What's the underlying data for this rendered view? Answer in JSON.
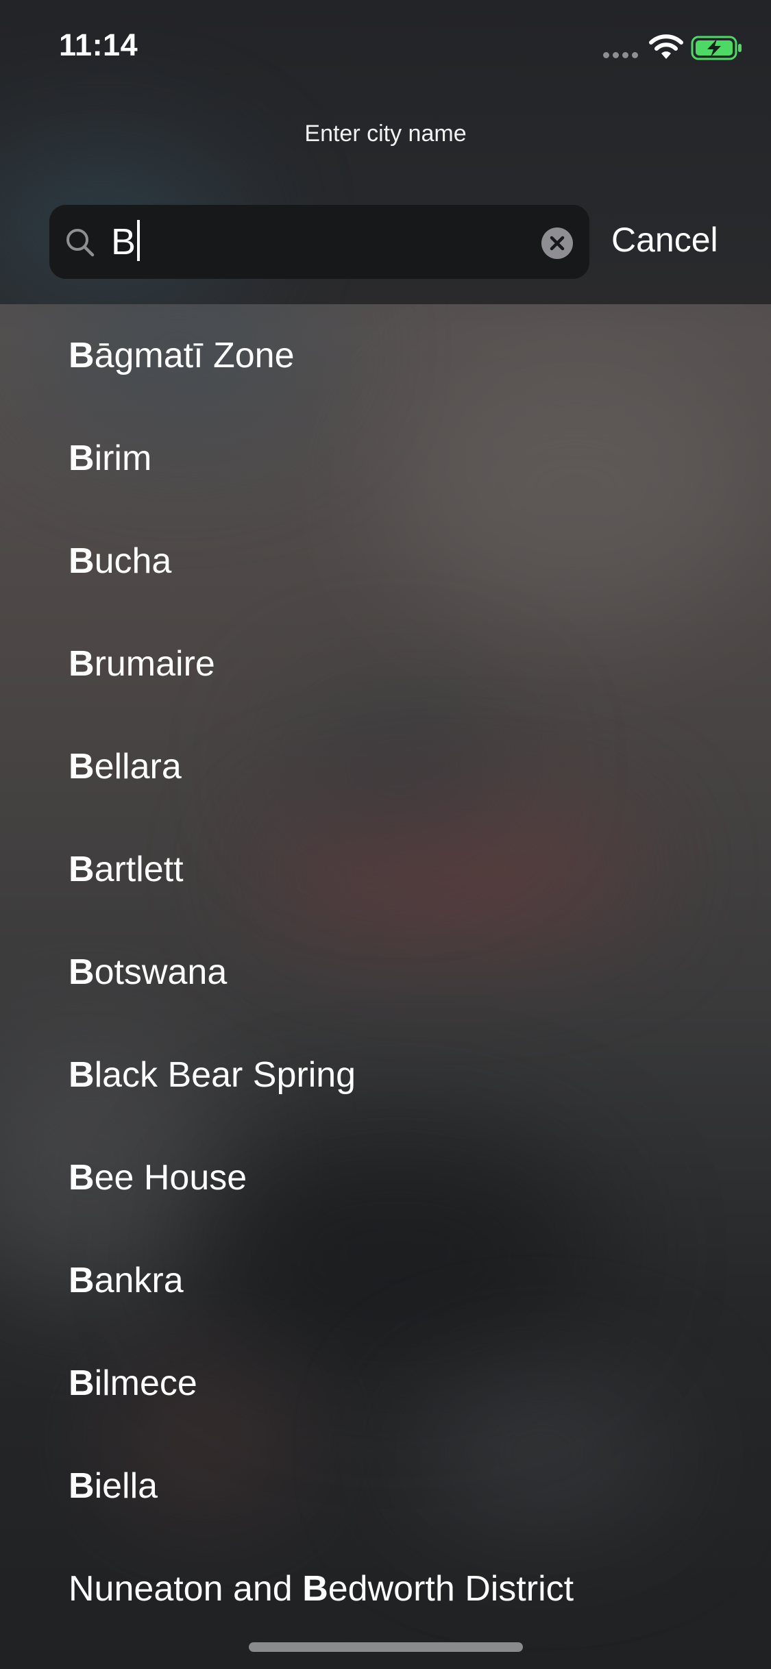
{
  "status_bar": {
    "time": "11:14"
  },
  "header": {
    "title": "Enter city name",
    "search": {
      "query": "B",
      "icon": "search-icon"
    },
    "cancel_label": "Cancel"
  },
  "results": [
    {
      "match": "B",
      "rest": "āgmatī Zone"
    },
    {
      "match": "B",
      "rest": "irim"
    },
    {
      "match": "B",
      "rest": "ucha"
    },
    {
      "match": "B",
      "rest": "rumaire"
    },
    {
      "match": "B",
      "rest": "ellara"
    },
    {
      "match": "B",
      "rest": "artlett"
    },
    {
      "match": "B",
      "rest": "otswana"
    },
    {
      "match": "B",
      "rest": "lack Bear Spring"
    },
    {
      "match": "B",
      "rest": "ee House"
    },
    {
      "match": "B",
      "rest": "ankra"
    },
    {
      "match": "B",
      "rest": "ilmece"
    },
    {
      "match": "B",
      "rest": "iella"
    },
    {
      "prefix": "Nuneaton and ",
      "match": "B",
      "rest": "edworth District"
    }
  ],
  "colors": {
    "battery_fill": "#4cd964",
    "clear_button": "#8e8e93"
  }
}
